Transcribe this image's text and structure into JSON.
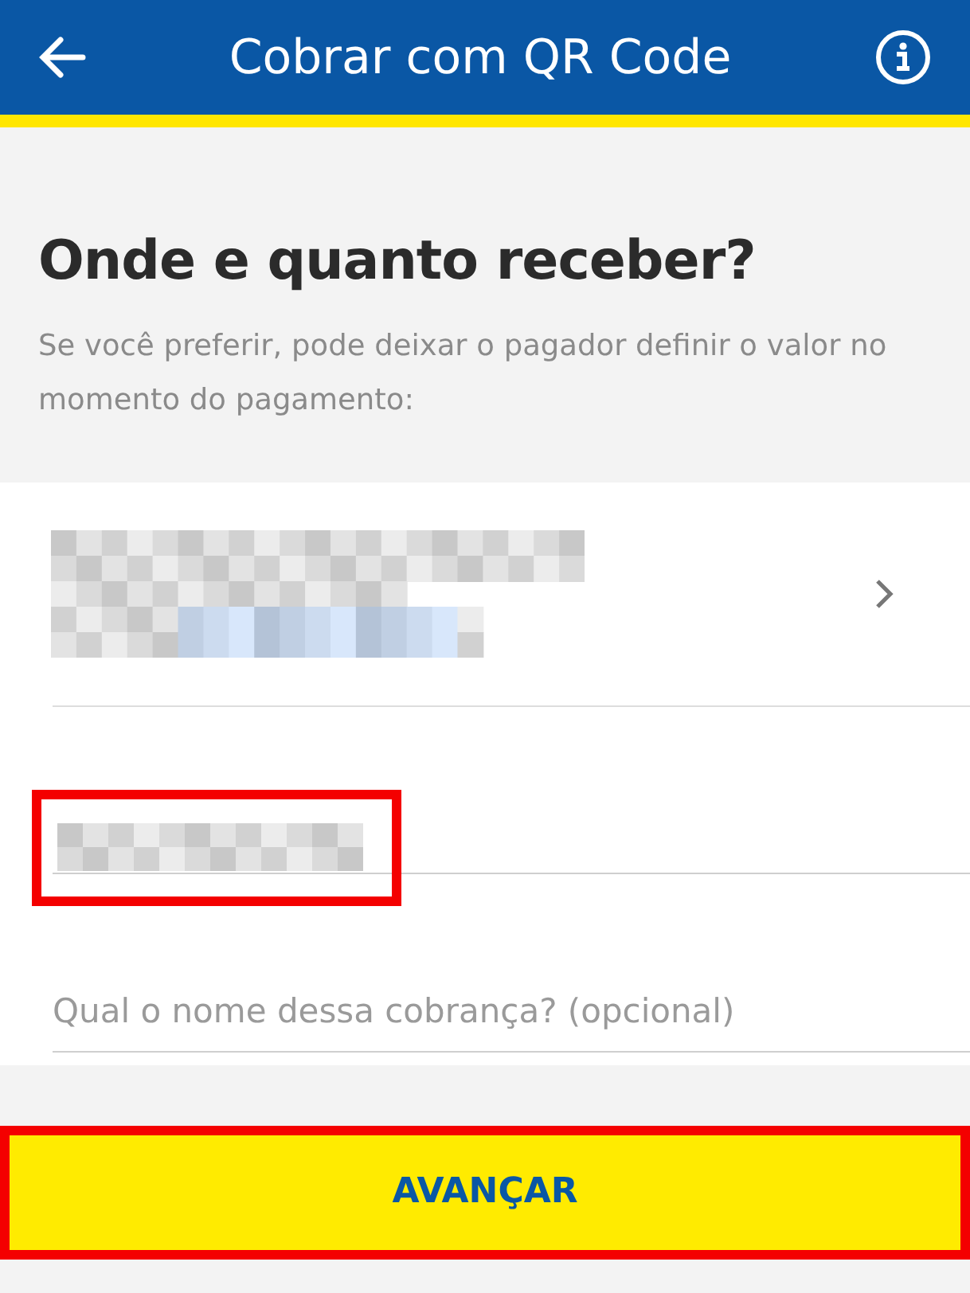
{
  "header": {
    "title": "Cobrar com QR Code"
  },
  "intro": {
    "heading": "Onde e quanto receber?",
    "text": "Se você preferir, pode deixar o pagador definir o valor no momento do pagamento:"
  },
  "account_row": {
    "redacted": true
  },
  "amount_field": {
    "redacted": true,
    "highlighted": true
  },
  "name_field": {
    "placeholder": "Qual o nome dessa cobrança? (opcional)"
  },
  "submit": {
    "label": "AVANÇAR",
    "highlighted": true
  }
}
